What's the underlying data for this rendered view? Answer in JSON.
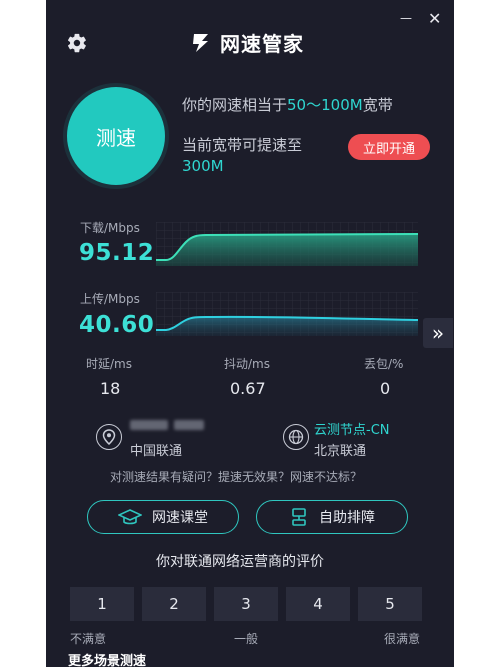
{
  "app": {
    "title": "网速管家"
  },
  "titlebar": {
    "minimize": "—",
    "close": "✕"
  },
  "speed_test": {
    "button_label": "测速"
  },
  "bandwidth": {
    "line1_prefix": "你的网速相当于",
    "line1_value": "50～100M",
    "line1_suffix": "宽带",
    "line2": "当前宽带可提速至",
    "line2_value": "300M",
    "open_button": "立即开通"
  },
  "download": {
    "label": "下载/Mbps",
    "value": "95.12",
    "color": "#3de0b8"
  },
  "upload": {
    "label": "上传/Mbps",
    "value": "40.60",
    "color": "#2fd0e0"
  },
  "stats": [
    {
      "label": "时延/ms",
      "value": "18"
    },
    {
      "label": "抖动/ms",
      "value": "0.67"
    },
    {
      "label": "丢包/%",
      "value": "0"
    }
  ],
  "local_node": {
    "isp": "中国联通"
  },
  "remote_node": {
    "name": "云测节点-CN",
    "isp": "北京联通"
  },
  "tip": "对测速结果有疑问？提速无效果？网速不达标？",
  "actions": {
    "classroom": "网速课堂",
    "troubleshoot": "自助排障"
  },
  "rating": {
    "title": "你对联通网络运营商的评价",
    "scores": [
      "1",
      "2",
      "3",
      "4",
      "5"
    ],
    "low": "不满意",
    "mid": "一般",
    "high": "很满意"
  },
  "more": "更多场景测速",
  "side_arrow": "»"
}
